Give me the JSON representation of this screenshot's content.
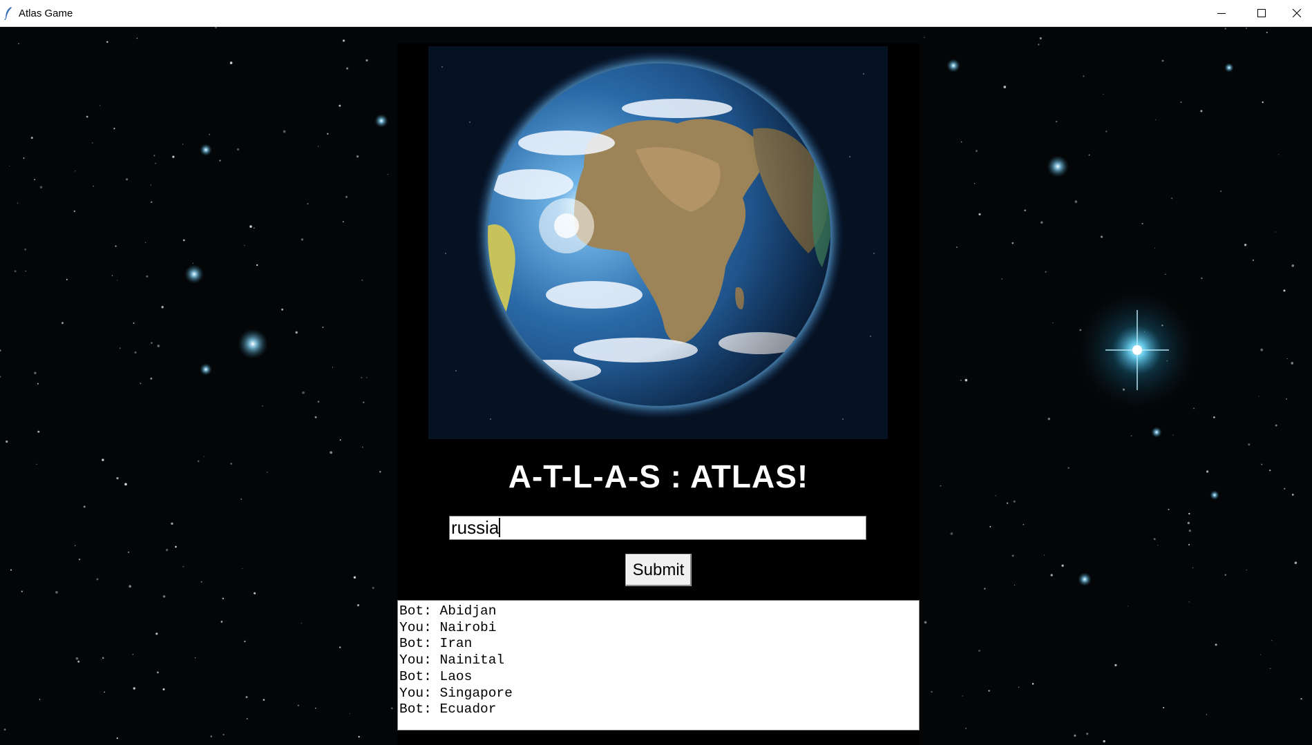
{
  "window": {
    "title": "Atlas Game",
    "controls": [
      "minimize-icon",
      "maximize-icon",
      "close-icon"
    ]
  },
  "app": {
    "heading": "A-T-L-A-S : ATLAS!",
    "input": {
      "value": "russia",
      "placeholder": ""
    },
    "submit_label": "Submit",
    "log": [
      "Bot: Abidjan",
      "You: Nairobi",
      "Bot: Iran",
      "You: Nainital",
      "Bot: Laos",
      "You: Singapore",
      "Bot: Ecuador"
    ]
  },
  "colors": {
    "background": "#000000",
    "heading": "#ffffff",
    "earth_panel": "#061122"
  }
}
